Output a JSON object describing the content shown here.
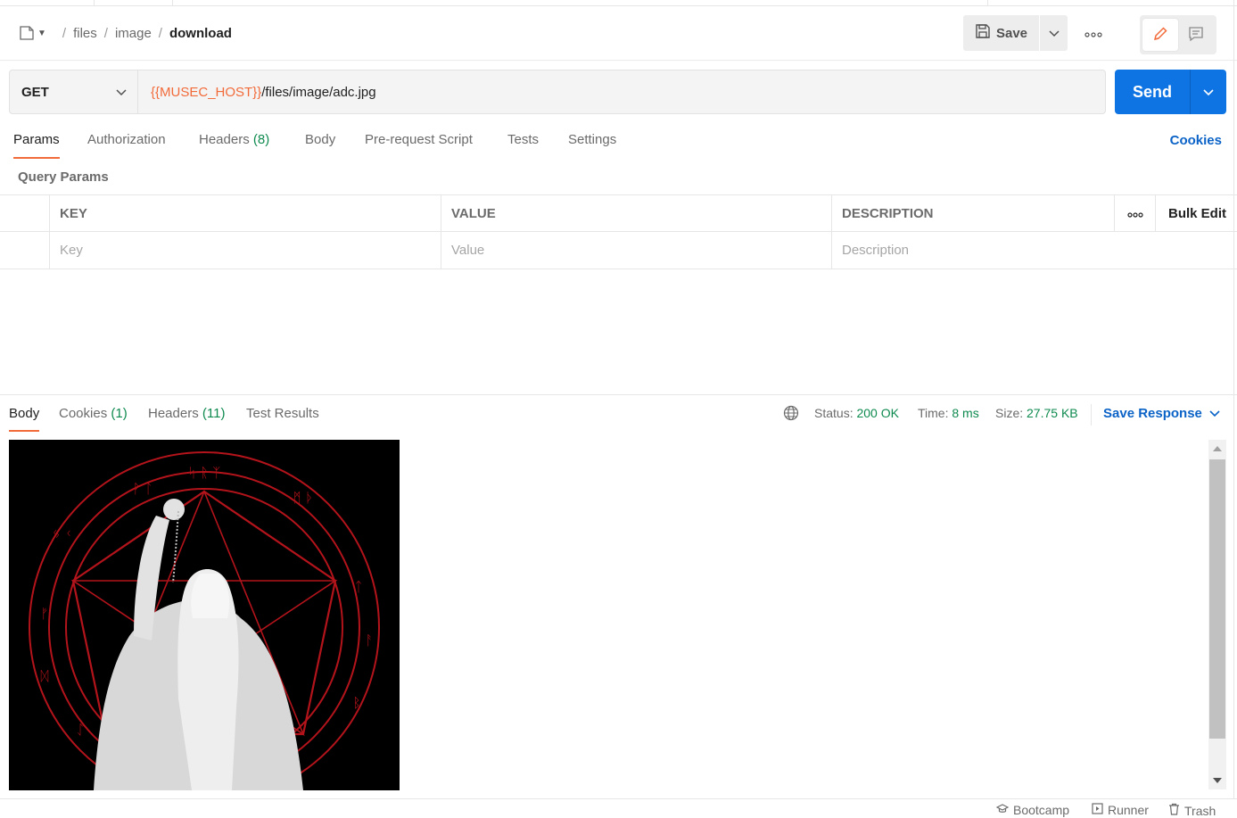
{
  "breadcrumb": {
    "items": [
      "files",
      "image"
    ],
    "separator": "/",
    "current": "download"
  },
  "toolbar": {
    "save_label": "Save",
    "more_icon": "ellipsis-icon"
  },
  "request": {
    "method": "GET",
    "url_variable": "{{MUSEC_HOST}}",
    "url_path": "/files/image/adc.jpg",
    "send_label": "Send"
  },
  "request_tabs": {
    "params": "Params",
    "authorization": "Authorization",
    "headers": "Headers",
    "headers_count": "(8)",
    "body": "Body",
    "prerequest": "Pre-request Script",
    "tests": "Tests",
    "settings": "Settings",
    "cookies": "Cookies"
  },
  "query_params": {
    "title": "Query Params",
    "columns": {
      "key": "KEY",
      "value": "VALUE",
      "description": "DESCRIPTION"
    },
    "bulk_edit": "Bulk Edit",
    "placeholders": {
      "key": "Key",
      "value": "Value",
      "description": "Description"
    }
  },
  "response": {
    "tabs": {
      "body": "Body",
      "cookies": "Cookies",
      "cookies_count": "(1)",
      "headers": "Headers",
      "headers_count": "(11)",
      "test_results": "Test Results"
    },
    "status_label": "Status:",
    "status_value": "200 OK",
    "time_label": "Time:",
    "time_value": "8 ms",
    "size_label": "Size:",
    "size_value": "27.75 KB",
    "save_response": "Save Response"
  },
  "footer": {
    "bootcamp": "Bootcamp",
    "runner": "Runner",
    "trash": "Trash"
  },
  "colors": {
    "accent": "#f26b3a",
    "send_blue": "#0f74e3",
    "link_blue": "#0b63c7",
    "success_green": "#0e8a4f",
    "image_ring_red": "#b3141b"
  }
}
